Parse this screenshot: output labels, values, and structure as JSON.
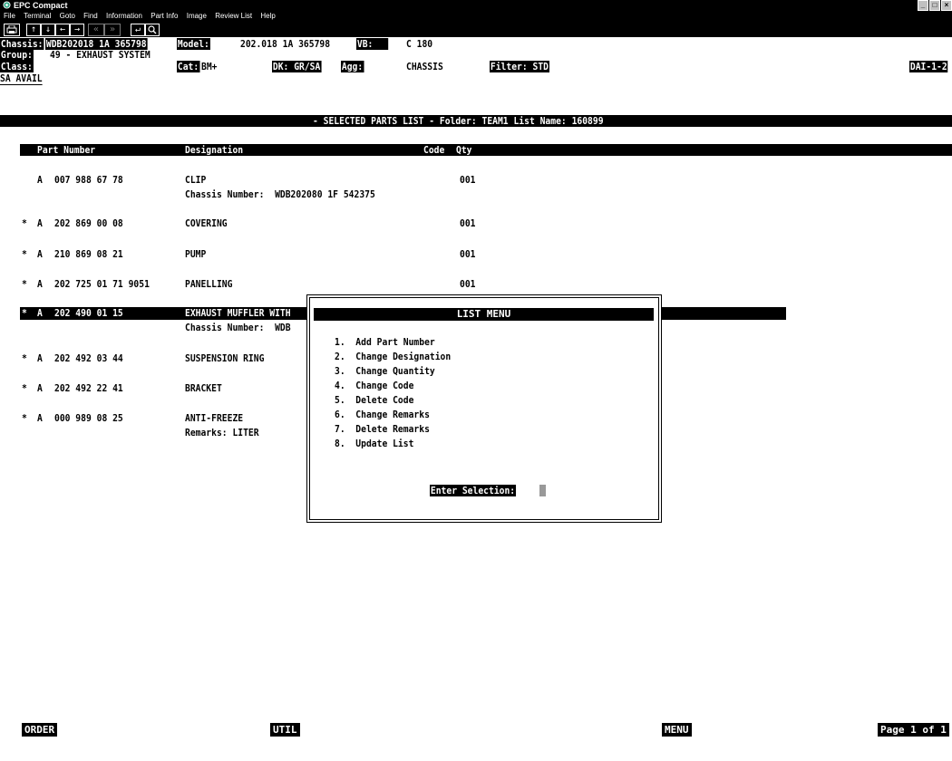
{
  "window": {
    "title": "EPC Compact",
    "buttons": [
      "_",
      "□",
      "×"
    ]
  },
  "menu": [
    "File",
    "Terminal",
    "Goto",
    "Find",
    "Information",
    "Part Info",
    "Image",
    "Review List",
    "Help"
  ],
  "toolbar": {
    "print_icon": "printer-icon",
    "arrows": [
      "↑",
      "↓",
      "←",
      "→"
    ],
    "prev_next": [
      "«",
      "»"
    ],
    "enter": "↵",
    "search": "search-icon"
  },
  "header": {
    "chassis_label": "Chassis:",
    "chassis": "WDB202018 1A 365798",
    "model_label": "Model:",
    "model": "202.018 1A 365798",
    "vb_label": "VB:",
    "vb": "C 180",
    "group_label": "Group:",
    "group": "49 - EXHAUST SYSTEM",
    "class_label": "Class:",
    "cat_label": "Cat:",
    "cat": "BM+",
    "dk_label": "DK: GR/SA",
    "agg_label": "Agg:",
    "agg": "CHASSIS",
    "filter_label": "Filter: STD",
    "dai": "DAI-1-2",
    "sa": "SA AVAIL"
  },
  "banner": "- SELECTED PARTS LIST - Folder: TEAM1 List Name: 160899",
  "columns": {
    "part": "Part Number",
    "designation": "Designation",
    "code": "Code",
    "qty": "Qty"
  },
  "rows": [
    {
      "mark": "",
      "prefix": "A",
      "part": "007 988 67 78",
      "designation": "CLIP",
      "sub": "Chassis Number:  WDB202080 1F 542375",
      "qty": "001"
    },
    {
      "mark": "*",
      "prefix": "A",
      "part": "202 869 00 08",
      "designation": "COVERING",
      "sub": "",
      "qty": "001"
    },
    {
      "mark": "*",
      "prefix": "A",
      "part": "210 869 08 21",
      "designation": "PUMP",
      "sub": "",
      "qty": "001"
    },
    {
      "mark": "*",
      "prefix": "A",
      "part": "202 725 01 71 9051",
      "designation": "PANELLING",
      "sub": "",
      "qty": "001"
    },
    {
      "mark": "*",
      "prefix": "A",
      "part": "202 490 01 15",
      "designation": "EXHAUST MUFFLER WITH",
      "sub": "Chassis Number:  WDB",
      "qty": ""
    },
    {
      "mark": "*",
      "prefix": "A",
      "part": "202 492 03 44",
      "designation": "SUSPENSION RING",
      "sub": "",
      "qty": ""
    },
    {
      "mark": "*",
      "prefix": "A",
      "part": "202 492 22 41",
      "designation": "BRACKET",
      "sub": "",
      "qty": ""
    },
    {
      "mark": "*",
      "prefix": "A",
      "part": "000 989 08 25",
      "designation": "ANTI-FREEZE",
      "sub": "Remarks: LITER",
      "qty": ""
    }
  ],
  "list_menu": {
    "title": "LIST MENU",
    "items": [
      "1.  Add Part Number",
      "2.  Change Designation",
      "3.  Change Quantity",
      "4.  Change Code",
      "5.  Delete Code",
      "6.  Change Remarks",
      "7.  Delete Remarks",
      "8.  Update List"
    ],
    "prompt": "Enter Selection:"
  },
  "footer": {
    "order": "ORDER",
    "util": "UTIL",
    "menu": "MENU",
    "page": "Page 1 of 1"
  }
}
